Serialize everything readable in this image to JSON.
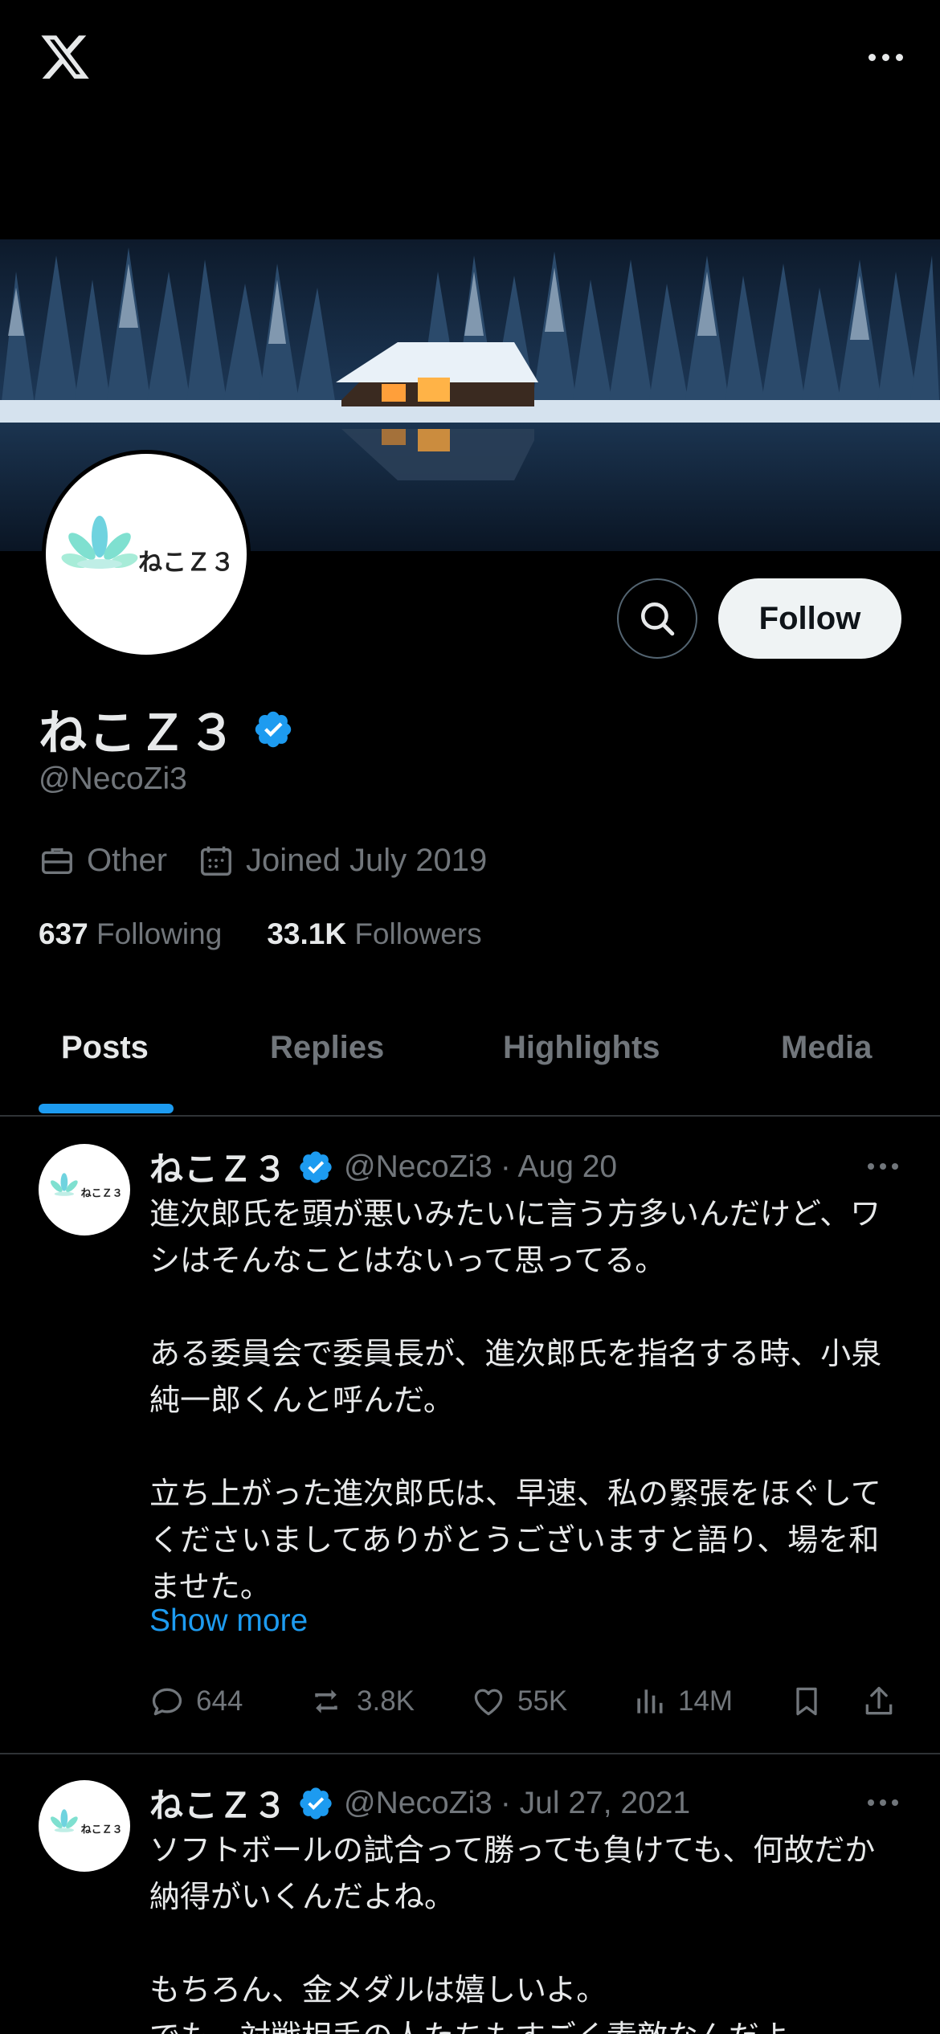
{
  "header": {
    "logo_icon": "x-logo-icon",
    "more_icon": "more-horizontal-icon"
  },
  "profile": {
    "avatar_text": "ねこＺ３",
    "name": "ねこＺ３",
    "handle": "@NecoZi3",
    "category": "Other",
    "joined": "Joined July 2019",
    "following_count": "637",
    "following_label": "Following",
    "followers_count": "33.1K",
    "followers_label": "Followers",
    "follow_label": "Follow",
    "verified_color": "#1d9bf0"
  },
  "tabs": [
    {
      "label": "Posts",
      "active": true
    },
    {
      "label": "Replies",
      "active": false
    },
    {
      "label": "Highlights",
      "active": false
    },
    {
      "label": "Media",
      "active": false
    }
  ],
  "posts": [
    {
      "name": "ねこＺ３",
      "handle": "@NecoZi3",
      "date": "· Aug 20",
      "body": "進次郎氏を頭が悪いみたいに言う方多いんだけど、ワシはそんなことはないって思ってる。\n\nある委員会で委員長が、進次郎氏を指名する時、小泉純一郎くんと呼んだ。\n\n立ち上がった進次郎氏は、早速、私の緊張をほぐしてくださいましてありがとうございますと語り、場を和ませた。",
      "show_more": "Show more",
      "replies": "644",
      "reposts": "3.8K",
      "likes": "55K",
      "views": "14M"
    },
    {
      "name": "ねこＺ３",
      "handle": "@NecoZi3",
      "date": "· Jul 27, 2021",
      "body": "ソフトボールの試合って勝っても負けても、何故だか納得がいくんだよね。\n\nもちろん、金メダルは嬉しいよ。\nでも、対戦相手の人たちもすごく素敵なんだよ"
    }
  ],
  "colors": {
    "background": "#000000",
    "accent": "#1d9bf0",
    "muted": "#71767b",
    "text": "#e7e9ea"
  }
}
